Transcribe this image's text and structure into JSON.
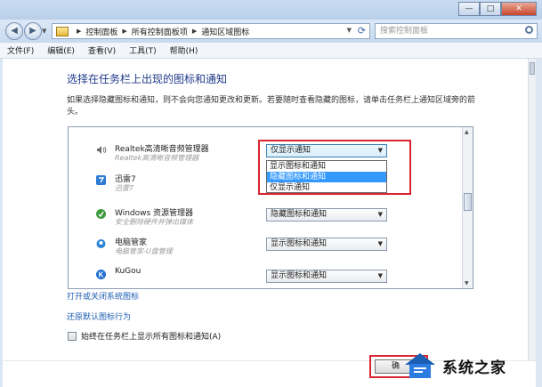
{
  "window": {
    "minimize": "—",
    "maximize": "□",
    "close": "✕"
  },
  "nav": {
    "back": "◀",
    "forward": "▶",
    "breadcrumb": [
      "控制面板",
      "所有控制面板项",
      "通知区域图标"
    ],
    "search_placeholder": "搜索控制面板"
  },
  "menu": [
    "文件(F)",
    "编辑(E)",
    "查看(V)",
    "工具(T)",
    "帮助(H)"
  ],
  "page": {
    "title": "选择在任务栏上出现的图标和通知",
    "description": "如果选择隐藏图标和通知，则不会向您通知更改和更新。若要随时查看隐藏的图标，请单击任务栏上通知区域旁的箭头。"
  },
  "items": [
    {
      "name": "Realtek高清晰音频管理器",
      "sub": "Realtek高清晰音频管理器",
      "selected": "仅显示通知",
      "icon": "speaker-icon"
    },
    {
      "name": "迅雷7",
      "sub": "迅雷7",
      "icon": "thunder-icon"
    },
    {
      "name": "Windows 资源管理器",
      "sub": "安全删除硬件并弹出媒体",
      "selected": "隐藏图标和通知",
      "icon": "usb-icon"
    },
    {
      "name": "电脑管家",
      "sub": "电脑管家-U盘管理",
      "selected": "显示图标和通知",
      "icon": "shield-icon"
    },
    {
      "name": "KuGou",
      "sub": "",
      "selected": "显示图标和通知",
      "icon": "kugou-icon"
    }
  ],
  "dropdown_options": [
    "显示图标和通知",
    "隐藏图标和通知",
    "仅显示通知"
  ],
  "dropdown_highlight": "隐藏图标和通知",
  "links": {
    "toggle_system_icons": "打开或关闭系统图标",
    "restore_defaults": "还原默认图标行为"
  },
  "checkbox": {
    "label": "始终在任务栏上显示所有图标和通知(A)",
    "checked": false
  },
  "ok_button": "确",
  "watermark": "系统之家",
  "colors": {
    "highlight": "#3399ff",
    "annotation_red": "#d9252f",
    "link": "#1d5eb3",
    "title": "#1e3a8a"
  }
}
